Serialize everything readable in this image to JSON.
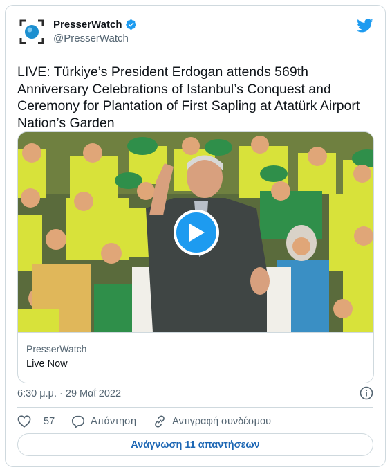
{
  "tweet": {
    "author_name": "PresserWatch",
    "author_handle": "@PresserWatch",
    "verified": true,
    "text": "LIVE: Türkiye’s President Erdogan attends 569th Anniversary Celebrations of Istanbul’s Conquest and Ceremony for Plantation of First Sapling at Atatürk Airport Nation’s Garden",
    "timestamp": "6:30 μ.μ. · 29 Μαΐ 2022"
  },
  "card": {
    "domain": "PresserWatch",
    "title": "Live Now"
  },
  "actions": {
    "like_count": "57",
    "reply_label": "Απάντηση",
    "copy_link_label": "Αντιγραφή συνδέσμου"
  },
  "footer": {
    "read_replies_label": "Ανάγνωση 11 απαντήσεων"
  },
  "icons": {
    "brand": "twitter-bird-icon",
    "verified": "verified-badge-icon",
    "play": "play-icon",
    "info": "info-icon",
    "like": "heart-icon",
    "reply": "speech-bubble-icon",
    "copy": "link-icon"
  },
  "colors": {
    "accent": "#1d9bf0",
    "text": "#0f1419",
    "secondary": "#536471",
    "border": "#cfd9de",
    "button_text": "#1d67b4"
  }
}
